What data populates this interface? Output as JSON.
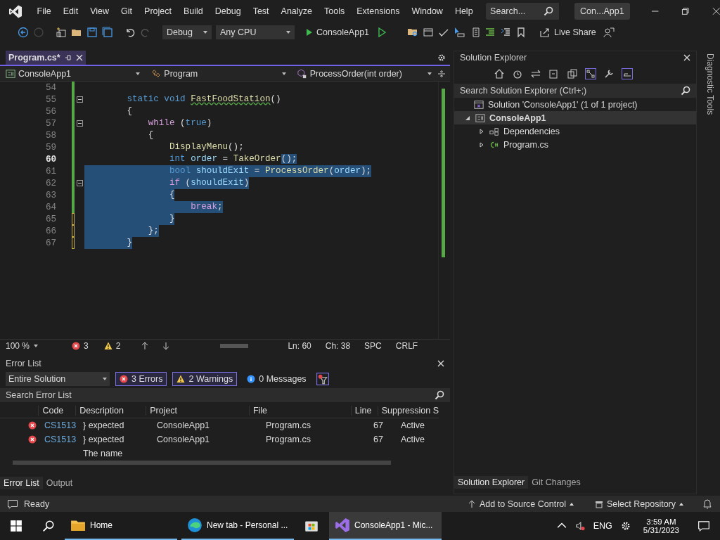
{
  "menu": [
    "File",
    "Edit",
    "View",
    "Git",
    "Project",
    "Build",
    "Debug",
    "Test",
    "Analyze",
    "Tools",
    "Extensions",
    "Window",
    "Help"
  ],
  "search": {
    "placeholder": "Search..."
  },
  "solution_badge": "Con...App1",
  "toolbar": {
    "configuration": "Debug",
    "platform": "Any CPU",
    "start_target": "ConsoleApp1",
    "live_share": "Live Share"
  },
  "document_tabs": [
    {
      "label": "Program.cs*",
      "selected": true
    }
  ],
  "nav_bar": {
    "project": "ConsoleApp1",
    "type": "Program",
    "member": "ProcessOrder(int order)"
  },
  "code_lines": [
    {
      "number": "54",
      "current": false,
      "saved": true,
      "foldable": false
    },
    {
      "number": "55",
      "current": false,
      "selected": false,
      "saved": true,
      "foldable": true,
      "tokens": [
        {
          "text": "        static void ",
          "kind": "keyword"
        },
        {
          "text": "FastFoodStation",
          "kind": "method",
          "squiggle": true
        },
        {
          "text": "()",
          "kind": "plain"
        }
      ]
    },
    {
      "number": "56",
      "current": false,
      "selected": false,
      "saved": true,
      "foldable": false,
      "tokens": [
        {
          "text": "        {",
          "kind": "plain"
        }
      ]
    },
    {
      "number": "57",
      "current": false,
      "selected": false,
      "saved": true,
      "foldable": true,
      "tokens": [
        {
          "text": "            while",
          "kind": "control"
        },
        {
          "text": " (",
          "kind": "plain"
        },
        {
          "text": "true",
          "kind": "keyword"
        },
        {
          "text": ")",
          "kind": "plain"
        }
      ]
    },
    {
      "number": "58",
      "current": false,
      "selected": false,
      "saved": true,
      "foldable": false,
      "tokens": [
        {
          "text": "            {",
          "kind": "plain"
        }
      ]
    },
    {
      "number": "59",
      "current": false,
      "selected": false,
      "saved": true,
      "foldable": false,
      "tokens": [
        {
          "text": "                DisplayMenu",
          "kind": "method"
        },
        {
          "text": "();",
          "kind": "plain"
        }
      ]
    },
    {
      "number": "60",
      "current": true,
      "selected": false,
      "saved": true,
      "foldable": false,
      "tokens": [
        {
          "text": "                int ",
          "kind": "keyword"
        },
        {
          "text": "order",
          "kind": "variable"
        },
        {
          "text": " = ",
          "kind": "plain"
        },
        {
          "text": "TakeOrder",
          "kind": "method"
        }
      ],
      "selected_tokens": [
        {
          "text": "();",
          "kind": "plain"
        }
      ]
    },
    {
      "number": "61",
      "current": false,
      "selected": true,
      "saved": true,
      "foldable": false,
      "tokens": [
        {
          "text": "                bool ",
          "kind": "keyword"
        },
        {
          "text": "shouldExit",
          "kind": "variable"
        },
        {
          "text": " = ",
          "kind": "plain"
        },
        {
          "text": "ProcessOrder",
          "kind": "method"
        },
        {
          "text": "(",
          "kind": "plain"
        },
        {
          "text": "order",
          "kind": "variable"
        },
        {
          "text": ");",
          "kind": "plain"
        }
      ]
    },
    {
      "number": "62",
      "current": false,
      "selected": true,
      "saved": true,
      "foldable": true,
      "tokens": [
        {
          "text": "                if",
          "kind": "control"
        },
        {
          "text": " (",
          "kind": "plain"
        },
        {
          "text": "shouldExit",
          "kind": "variable"
        },
        {
          "text": ")",
          "kind": "plain"
        }
      ]
    },
    {
      "number": "63",
      "current": false,
      "selected": true,
      "saved": true,
      "foldable": false,
      "tokens": [
        {
          "text": "                {",
          "kind": "plain"
        }
      ]
    },
    {
      "number": "64",
      "current": false,
      "selected": true,
      "saved": true,
      "foldable": false,
      "tokens": [
        {
          "text": "                    break",
          "kind": "control"
        },
        {
          "text": ";",
          "kind": "plain"
        }
      ]
    },
    {
      "number": "65",
      "current": false,
      "selected": true,
      "saved": false,
      "foldable": false,
      "tokens": [
        {
          "text": "                }",
          "kind": "plain"
        }
      ]
    },
    {
      "number": "66",
      "current": false,
      "selected": true,
      "saved": false,
      "foldable": false,
      "tokens": [
        {
          "text": "            };",
          "kind": "plain"
        }
      ]
    },
    {
      "number": "67",
      "current": false,
      "selected": true,
      "saved": false,
      "foldable": false,
      "tokens": [
        {
          "text": "        }",
          "kind": "plain"
        }
      ]
    }
  ],
  "editor_status": {
    "zoom": "100 %",
    "errors": "3",
    "warnings": "2",
    "line": "Ln: 60",
    "column": "Ch: 38",
    "indent": "SPC",
    "line_ending": "CRLF"
  },
  "error_list": {
    "title": "Error List",
    "scope": "Entire Solution",
    "filters": [
      {
        "kind": "error",
        "label": "3 Errors",
        "selected": true
      },
      {
        "kind": "warning",
        "label": "2 Warnings",
        "selected": true
      },
      {
        "kind": "info",
        "label": "0 Messages",
        "selected": false
      }
    ],
    "search_placeholder": "Search Error List",
    "columns": [
      "Code",
      "Description",
      "Project",
      "File",
      "Line",
      "Suppression S"
    ],
    "rows": [
      {
        "kind": "error",
        "code": "CS1513",
        "description": "} expected",
        "project": "ConsoleApp1",
        "file": "Program.cs",
        "line": "67",
        "suppression": "Active"
      },
      {
        "kind": "error",
        "code": "CS1513",
        "description": "} expected",
        "project": "ConsoleApp1",
        "file": "Program.cs",
        "line": "67",
        "suppression": "Active"
      },
      {
        "kind": "partial",
        "description": "The name"
      }
    ]
  },
  "bottom_tabs": [
    {
      "label": "Error List",
      "selected": true
    },
    {
      "label": "Output",
      "selected": false
    }
  ],
  "solution_explorer": {
    "title": "Solution Explorer",
    "search_placeholder": "Search Solution Explorer (Ctrl+;)",
    "tree": [
      {
        "label": "Solution 'ConsoleApp1' (1 of 1 project)",
        "kind": "solution",
        "expanded": true,
        "selected": false,
        "children": [
          {
            "label": "ConsoleApp1",
            "kind": "project",
            "expanded": true,
            "selected": true,
            "children": [
              {
                "label": "Dependencies",
                "kind": "dependencies",
                "expanded": false,
                "selected": false
              },
              {
                "label": "Program.cs",
                "kind": "csharp",
                "expanded": false,
                "selected": false
              }
            ]
          }
        ]
      }
    ]
  },
  "right_tabs": [
    {
      "label": "Solution Explorer",
      "selected": true
    },
    {
      "label": "Git Changes",
      "selected": false
    }
  ],
  "side_tab": "Diagnostic Tools",
  "status_bar": {
    "state": "Ready",
    "source_control": "Add to Source Control",
    "repository": "Select Repository"
  },
  "taskbar": {
    "apps": [
      {
        "kind": "folder",
        "label": "Home",
        "running": true,
        "selected": false
      },
      {
        "kind": "browser",
        "label": "New tab - Personal ...",
        "running": true,
        "selected": false
      },
      {
        "kind": "store",
        "running": false,
        "selected": false
      },
      {
        "kind": "vs",
        "label": "ConsoleApp1 - Mic...",
        "running": true,
        "selected": true
      }
    ],
    "language": "ENG",
    "time": "3:59 AM",
    "date": "5/31/2023"
  }
}
